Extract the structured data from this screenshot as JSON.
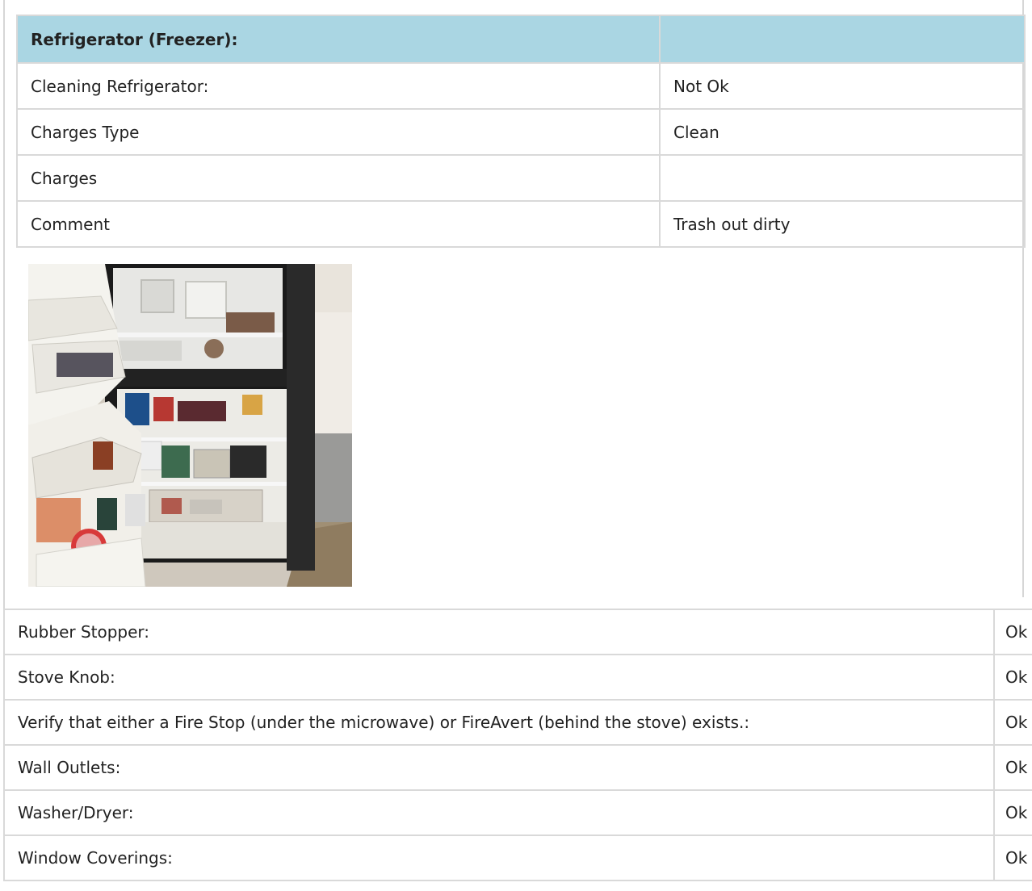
{
  "section": {
    "title": "Refrigerator (Freezer):",
    "title_value": "",
    "rows": [
      {
        "label": "Cleaning Refrigerator:",
        "value": "Not Ok"
      },
      {
        "label": "Charges Type",
        "value": "Clean"
      },
      {
        "label": "Charges",
        "value": ""
      },
      {
        "label": "Comment",
        "value": "Trash out dirty"
      }
    ]
  },
  "items": [
    {
      "label": "Rubber Stopper:",
      "value": "Ok"
    },
    {
      "label": "Stove Knob:",
      "value": "Ok"
    },
    {
      "label": "Verify that either a Fire Stop (under the microwave) or FireAvert (behind the stove) exists.:",
      "value": "Ok"
    },
    {
      "label": "Wall Outlets:",
      "value": "Ok"
    },
    {
      "label": "Washer/Dryer:",
      "value": "Ok"
    },
    {
      "label": "Window Coverings:",
      "value": "Ok"
    }
  ],
  "colors": {
    "header_bg": "#aad6e3",
    "border": "#d9d9d9"
  }
}
